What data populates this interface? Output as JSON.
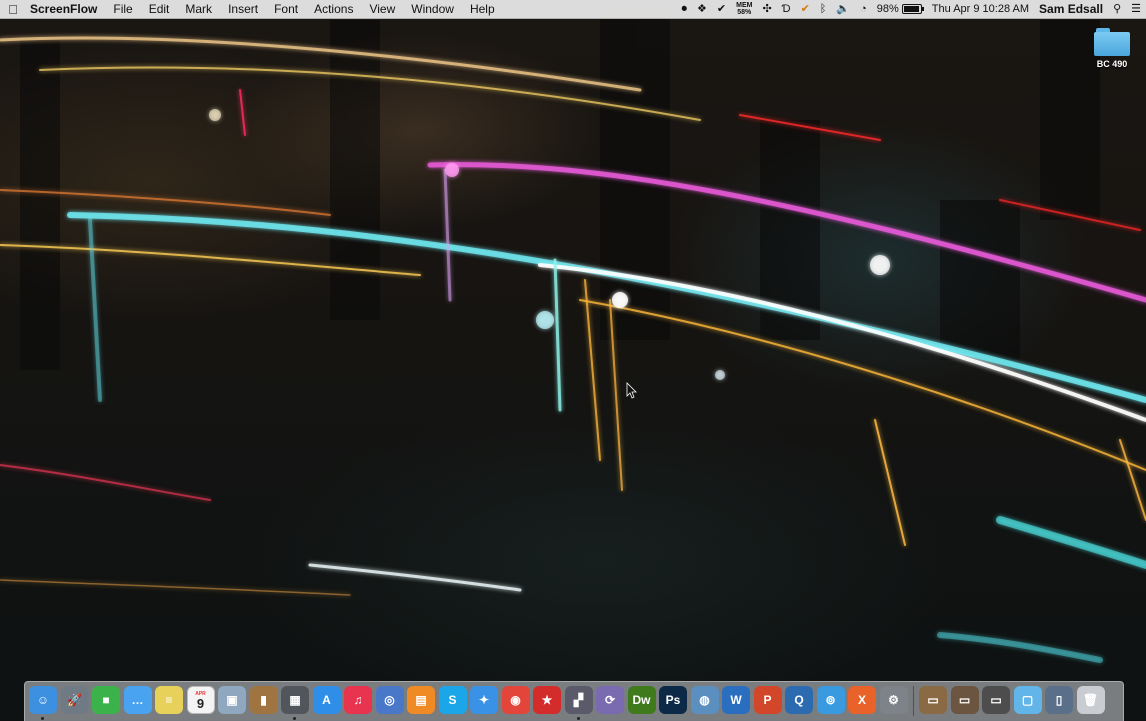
{
  "menubar": {
    "app_name": "ScreenFlow",
    "menus": [
      "File",
      "Edit",
      "Mark",
      "Insert",
      "Font",
      "Actions",
      "View",
      "Window",
      "Help"
    ],
    "status": {
      "memory_label": "MEM",
      "memory_value": "58%",
      "battery_percent": "98%",
      "battery_level": 0.98,
      "datetime": "Thu Apr 9  10:28 AM",
      "user": "Sam Edsall"
    }
  },
  "desktop": {
    "folder_label": "BC 490"
  },
  "dock": {
    "calendar": {
      "month": "APR",
      "day": "9"
    },
    "items": [
      {
        "name": "finder-icon",
        "glyph": "☺",
        "color": "#3d8fe0"
      },
      {
        "name": "launchpad-icon",
        "glyph": "🚀",
        "color": "#6f7a85"
      },
      {
        "name": "facetime-icon",
        "glyph": "■",
        "color": "#3bb34a"
      },
      {
        "name": "messages-icon",
        "glyph": "…",
        "color": "#4aa3f0"
      },
      {
        "name": "stickies-icon",
        "glyph": "≡",
        "color": "#e7d15a"
      },
      {
        "name": "calendar-icon",
        "glyph": "",
        "color": "#f4f4f4"
      },
      {
        "name": "preview-icon",
        "glyph": "▣",
        "color": "#8fa8c0"
      },
      {
        "name": "notebook-icon",
        "glyph": "▮",
        "color": "#a07440"
      },
      {
        "name": "claquette-icon",
        "glyph": "▦",
        "color": "#50565c"
      },
      {
        "name": "app-store-icon",
        "glyph": "A",
        "color": "#2f8fe8"
      },
      {
        "name": "itunes-icon",
        "glyph": "♫",
        "color": "#e8344f"
      },
      {
        "name": "dvd-player-icon",
        "glyph": "◎",
        "color": "#4a78c8"
      },
      {
        "name": "ibooks-icon",
        "glyph": "▤",
        "color": "#f08a24"
      },
      {
        "name": "skype-icon",
        "glyph": "S",
        "color": "#1aa6e8"
      },
      {
        "name": "safari-icon",
        "glyph": "✦",
        "color": "#3a92e6"
      },
      {
        "name": "chrome-icon",
        "glyph": "◉",
        "color": "#e4453a"
      },
      {
        "name": "flashcard-icon",
        "glyph": "★",
        "color": "#d42b2b"
      },
      {
        "name": "final-cut-icon",
        "glyph": "▞",
        "color": "#5a5a6a"
      },
      {
        "name": "motion-icon",
        "glyph": "⟳",
        "color": "#7a6ab0"
      },
      {
        "name": "dreamweaver-icon",
        "glyph": "Dw",
        "color": "#3f7a1c"
      },
      {
        "name": "photoshop-icon",
        "glyph": "Ps",
        "color": "#0c2a47"
      },
      {
        "name": "screenflow-icon",
        "glyph": "◍",
        "color": "#5b8fc0"
      },
      {
        "name": "word-icon",
        "glyph": "W",
        "color": "#2a6ebf"
      },
      {
        "name": "powerpoint-icon",
        "glyph": "P",
        "color": "#d2462a"
      },
      {
        "name": "quicktime-icon",
        "glyph": "Q",
        "color": "#2d6bb0"
      },
      {
        "name": "crossover-icon",
        "glyph": "⊚",
        "color": "#3a9ae0"
      },
      {
        "name": "x-app-icon",
        "glyph": "X",
        "color": "#e8622a"
      },
      {
        "name": "system-preferences-icon",
        "glyph": "⚙",
        "color": "#7d8389"
      },
      {
        "name": "stack-1-icon",
        "glyph": "▭",
        "color": "#8a6a45"
      },
      {
        "name": "stack-2-icon",
        "glyph": "▭",
        "color": "#6b5540"
      },
      {
        "name": "stack-3-icon",
        "glyph": "▭",
        "color": "#4d4d4d"
      },
      {
        "name": "downloads-folder-icon",
        "glyph": "▢",
        "color": "#62b5e8"
      },
      {
        "name": "document-icon",
        "glyph": "▯",
        "color": "#5a6f8a"
      },
      {
        "name": "trash-icon",
        "glyph": "🗑",
        "color": "#c9cdd1"
      }
    ]
  }
}
